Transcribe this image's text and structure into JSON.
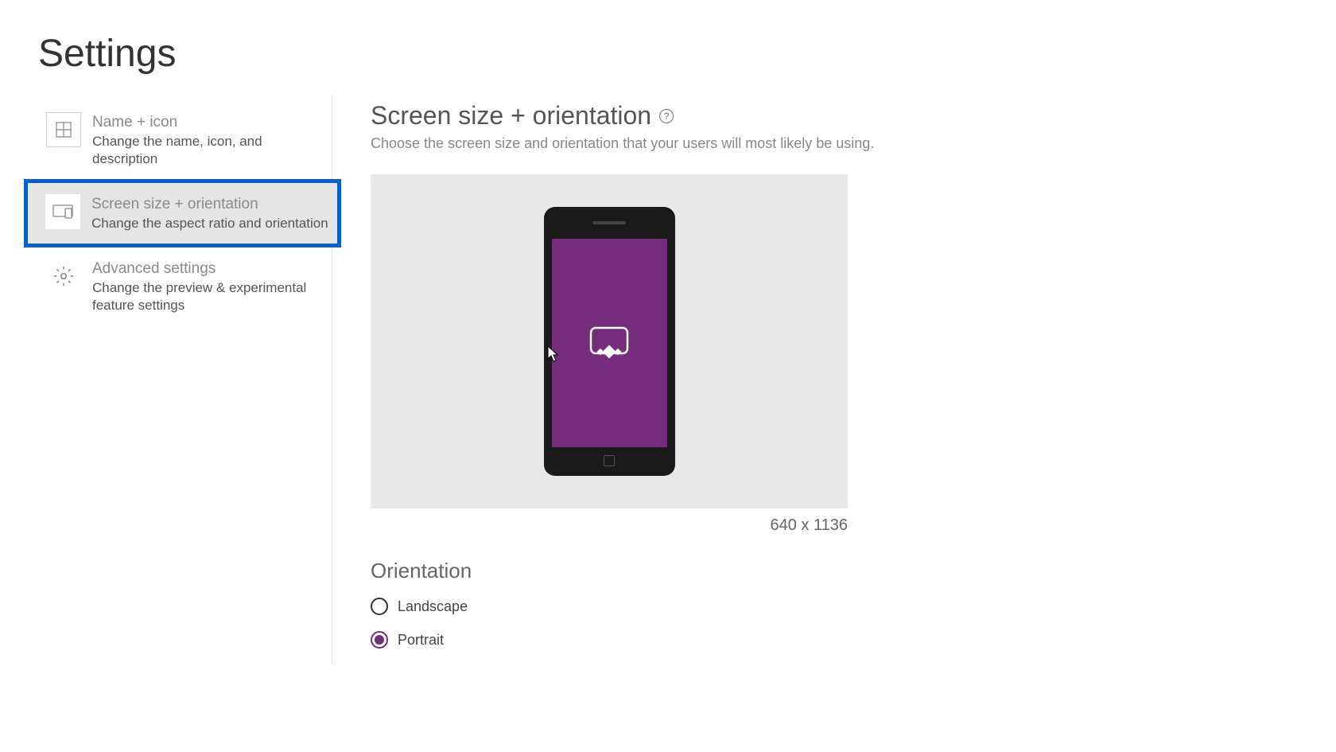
{
  "page": {
    "title": "Settings"
  },
  "sidebar": {
    "items": [
      {
        "title": "Name + icon",
        "description": "Change the name, icon, and description"
      },
      {
        "title": "Screen size + orientation",
        "description": "Change the aspect ratio and orientation"
      },
      {
        "title": "Advanced settings",
        "description": "Change the preview & experimental feature settings"
      }
    ]
  },
  "content": {
    "title": "Screen size + orientation",
    "subtitle": "Choose the screen size and orientation that your users will most likely be using.",
    "dimensions": "640 x 1136",
    "orientation": {
      "title": "Orientation",
      "options": {
        "landscape": "Landscape",
        "portrait": "Portrait"
      },
      "selected": "portrait"
    }
  },
  "colors": {
    "accent": "#742d7b",
    "highlight": "#0a5ec7"
  }
}
